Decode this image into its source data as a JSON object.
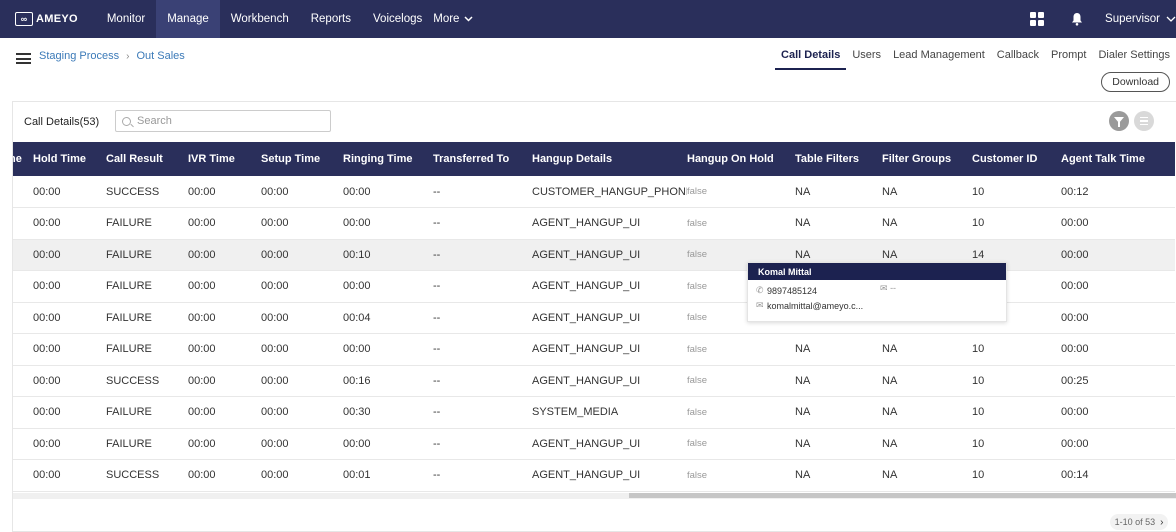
{
  "app": {
    "logo_text": "AMEYO",
    "nav": [
      "Monitor",
      "Manage",
      "Workbench",
      "Reports",
      "Voicelogs",
      "More"
    ],
    "active_nav": "Manage",
    "user": "Supervisor"
  },
  "breadcrumb": [
    "Staging Process",
    "Out Sales"
  ],
  "tabs": [
    "Call Details",
    "Users",
    "Lead Management",
    "Callback",
    "Prompt",
    "Dialer Settings"
  ],
  "active_tab": "Call Details",
  "download_label": "Download",
  "panel": {
    "title": "Call Details(53)",
    "search_placeholder": "Search"
  },
  "columns": [
    "ne",
    "Hold Time",
    "Call Result",
    "IVR Time",
    "Setup Time",
    "Ringing Time",
    "Transferred To",
    "Hangup Details",
    "Hangup On Hold",
    "Table Filters",
    "Filter Groups",
    "Customer ID",
    "Agent Talk Time"
  ],
  "rows": [
    [
      "",
      "00:00",
      "SUCCESS",
      "00:00",
      "00:00",
      "00:00",
      "--",
      "CUSTOMER_HANGUP_PHONE",
      "false",
      "NA",
      "NA",
      "10",
      "00:12"
    ],
    [
      "",
      "00:00",
      "FAILURE",
      "00:00",
      "00:00",
      "00:00",
      "--",
      "AGENT_HANGUP_UI",
      "false",
      "NA",
      "NA",
      "10",
      "00:00"
    ],
    [
      "",
      "00:00",
      "FAILURE",
      "00:00",
      "00:00",
      "00:10",
      "--",
      "AGENT_HANGUP_UI",
      "false",
      "NA",
      "NA",
      "14",
      "00:00"
    ],
    [
      "",
      "00:00",
      "FAILURE",
      "00:00",
      "00:00",
      "00:00",
      "--",
      "AGENT_HANGUP_UI",
      "false",
      "",
      "",
      "",
      "00:00"
    ],
    [
      "",
      "00:00",
      "FAILURE",
      "00:00",
      "00:00",
      "00:04",
      "--",
      "AGENT_HANGUP_UI",
      "false",
      "",
      "",
      "",
      "00:00"
    ],
    [
      "",
      "00:00",
      "FAILURE",
      "00:00",
      "00:00",
      "00:00",
      "--",
      "AGENT_HANGUP_UI",
      "false",
      "NA",
      "NA",
      "10",
      "00:00"
    ],
    [
      "",
      "00:00",
      "SUCCESS",
      "00:00",
      "00:00",
      "00:16",
      "--",
      "AGENT_HANGUP_UI",
      "false",
      "NA",
      "NA",
      "10",
      "00:25"
    ],
    [
      "",
      "00:00",
      "FAILURE",
      "00:00",
      "00:00",
      "00:30",
      "--",
      "SYSTEM_MEDIA",
      "false",
      "NA",
      "NA",
      "10",
      "00:00"
    ],
    [
      "",
      "00:00",
      "FAILURE",
      "00:00",
      "00:00",
      "00:00",
      "--",
      "AGENT_HANGUP_UI",
      "false",
      "NA",
      "NA",
      "10",
      "00:00"
    ],
    [
      "",
      "00:00",
      "SUCCESS",
      "00:00",
      "00:00",
      "00:01",
      "--",
      "AGENT_HANGUP_UI",
      "false",
      "NA",
      "NA",
      "10",
      "00:14"
    ]
  ],
  "highlighted_row": 2,
  "popover": {
    "name": "Komal Mittal",
    "phone": "9897485124",
    "email_secondary": "--",
    "email": "komalmittal@ameyo.c..."
  },
  "pagination": {
    "label": "1-10 of 53",
    "next": "›"
  },
  "icons": [
    "hamburger-icon",
    "apps-grid-icon",
    "bell-icon",
    "chevron-down-icon",
    "search-icon",
    "filter-icon",
    "list-icon",
    "phone-icon",
    "mail-icon"
  ],
  "colors": {
    "topbar": "#2a2f5b",
    "table_header": "#2a2f5b",
    "link": "#3b7ab8"
  }
}
